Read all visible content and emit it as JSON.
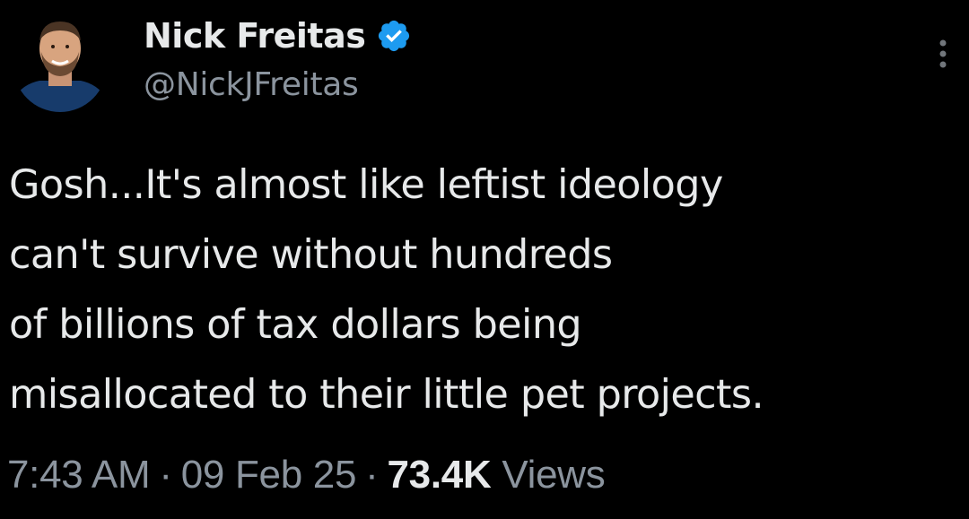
{
  "author": {
    "display_name": "Nick Freitas",
    "handle": "@NickJFreitas",
    "verified": true,
    "verified_color": "#1d9bf0",
    "avatar": "profile-photo"
  },
  "tweet": {
    "lines": [
      "Gosh...It's almost like leftist ideology",
      "can't survive without hundreds",
      "of billions of tax dollars being",
      "misallocated to their little pet projects."
    ]
  },
  "meta": {
    "time": "7:43 AM",
    "separator": "·",
    "date": "09 Feb 25",
    "views_count": "73.4K",
    "views_label": "Views"
  },
  "icons": {
    "more": "more-options-icon",
    "verified": "verified-badge-icon"
  },
  "colors": {
    "background": "#000000",
    "primary_text": "#e7e9ea",
    "secondary_text": "#8b949e"
  }
}
